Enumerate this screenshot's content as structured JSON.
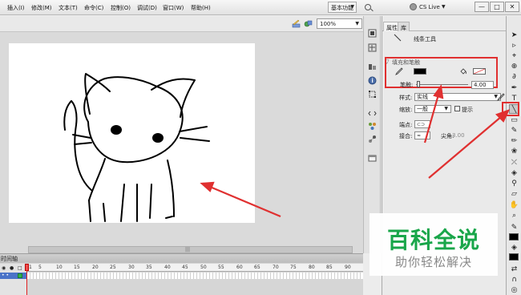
{
  "menubar": {
    "items": [
      "插入(I)",
      "修改(M)",
      "文本(T)",
      "命令(C)",
      "控制(O)",
      "调试(D)",
      "窗口(W)",
      "帮助(H)"
    ],
    "workspace_label": "基本功能",
    "cs_live_label": "CS Live",
    "window_buttons": [
      "—",
      "□",
      "✕"
    ]
  },
  "stage": {
    "zoom_value": "100%"
  },
  "properties": {
    "tabs": [
      "属性",
      "库"
    ],
    "tool_name": "线条工具",
    "section_title": "填充和笔触",
    "stroke_label": "笔触:",
    "stroke_value": "4.00",
    "style_label": "样式:",
    "style_value": "实线",
    "scale_label": "缩放:",
    "scale_value": "一般",
    "hint_label": "提示",
    "cap_label": "端点:",
    "join_label": "接合:",
    "miter_label": "尖角:",
    "miter_value": "3.00",
    "colors": {
      "stroke": "#000000",
      "fill": "#ffffff"
    }
  },
  "timeline": {
    "title": "时间轴",
    "frame_numbers": [
      "1",
      "5",
      "10",
      "15",
      "20",
      "25",
      "30",
      "35",
      "40",
      "45",
      "50",
      "55",
      "60",
      "65",
      "70",
      "75",
      "80",
      "85",
      "90"
    ]
  },
  "watermark": {
    "title": "百科全说",
    "subtitle": "助你轻松解决"
  },
  "icons": [
    "search-icon",
    "cs-live-icon",
    "line-tool-icon",
    "pencil-icon",
    "paint-bucket-icon",
    "selection-icon",
    "zoom-icon",
    "hand-icon"
  ],
  "accent_colors": {
    "annotation_red": "#e03030",
    "watermark_green": "#19a64a"
  }
}
